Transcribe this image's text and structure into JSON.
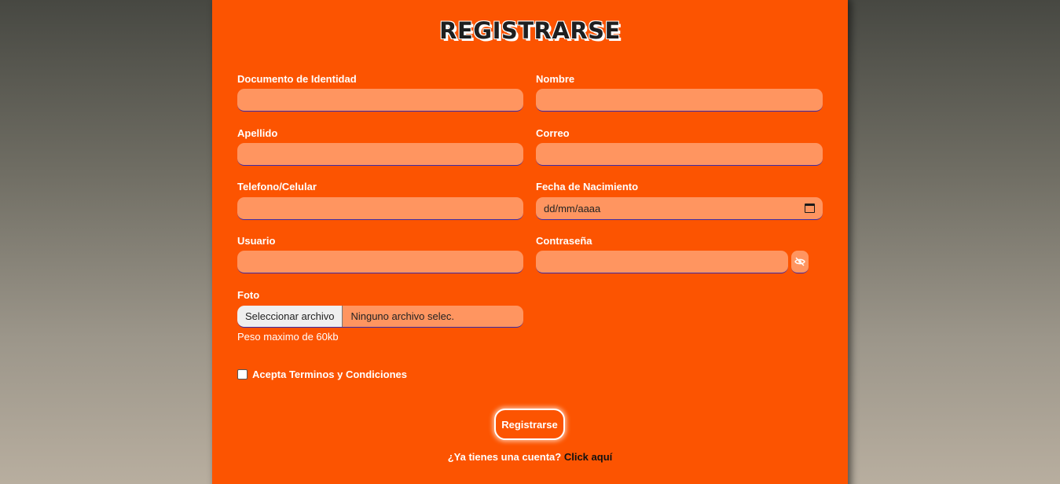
{
  "form": {
    "title": "REGISTRARSE",
    "fields": {
      "documento": {
        "label": "Documento de Identidad",
        "value": ""
      },
      "nombre": {
        "label": "Nombre",
        "value": ""
      },
      "apellido": {
        "label": "Apellido",
        "value": ""
      },
      "correo": {
        "label": "Correo",
        "value": ""
      },
      "telefono": {
        "label": "Telefono/Celular",
        "value": ""
      },
      "fecha": {
        "label": "Fecha de Nacimiento",
        "placeholder": "dd/mm/aaaa"
      },
      "usuario": {
        "label": "Usuario",
        "value": ""
      },
      "contrasena": {
        "label": "Contraseña",
        "value": "",
        "toggle_icon": "eye-slash-icon"
      },
      "foto": {
        "label": "Foto",
        "button_label": "Seleccionar archivo",
        "status": "Ninguno archivo selec.",
        "hint": "Peso maximo de 60kb"
      }
    },
    "terms_label": "Acepta Terminos y Condiciones",
    "submit_label": "Registrarse",
    "login_prompt": "¿Ya tienes una cuenta?",
    "login_link": "Click aquí"
  },
  "colors": {
    "card": "#fc5401",
    "input": "#ff9560",
    "background_top": "#474842",
    "background_bottom": "#b8ae9f"
  }
}
